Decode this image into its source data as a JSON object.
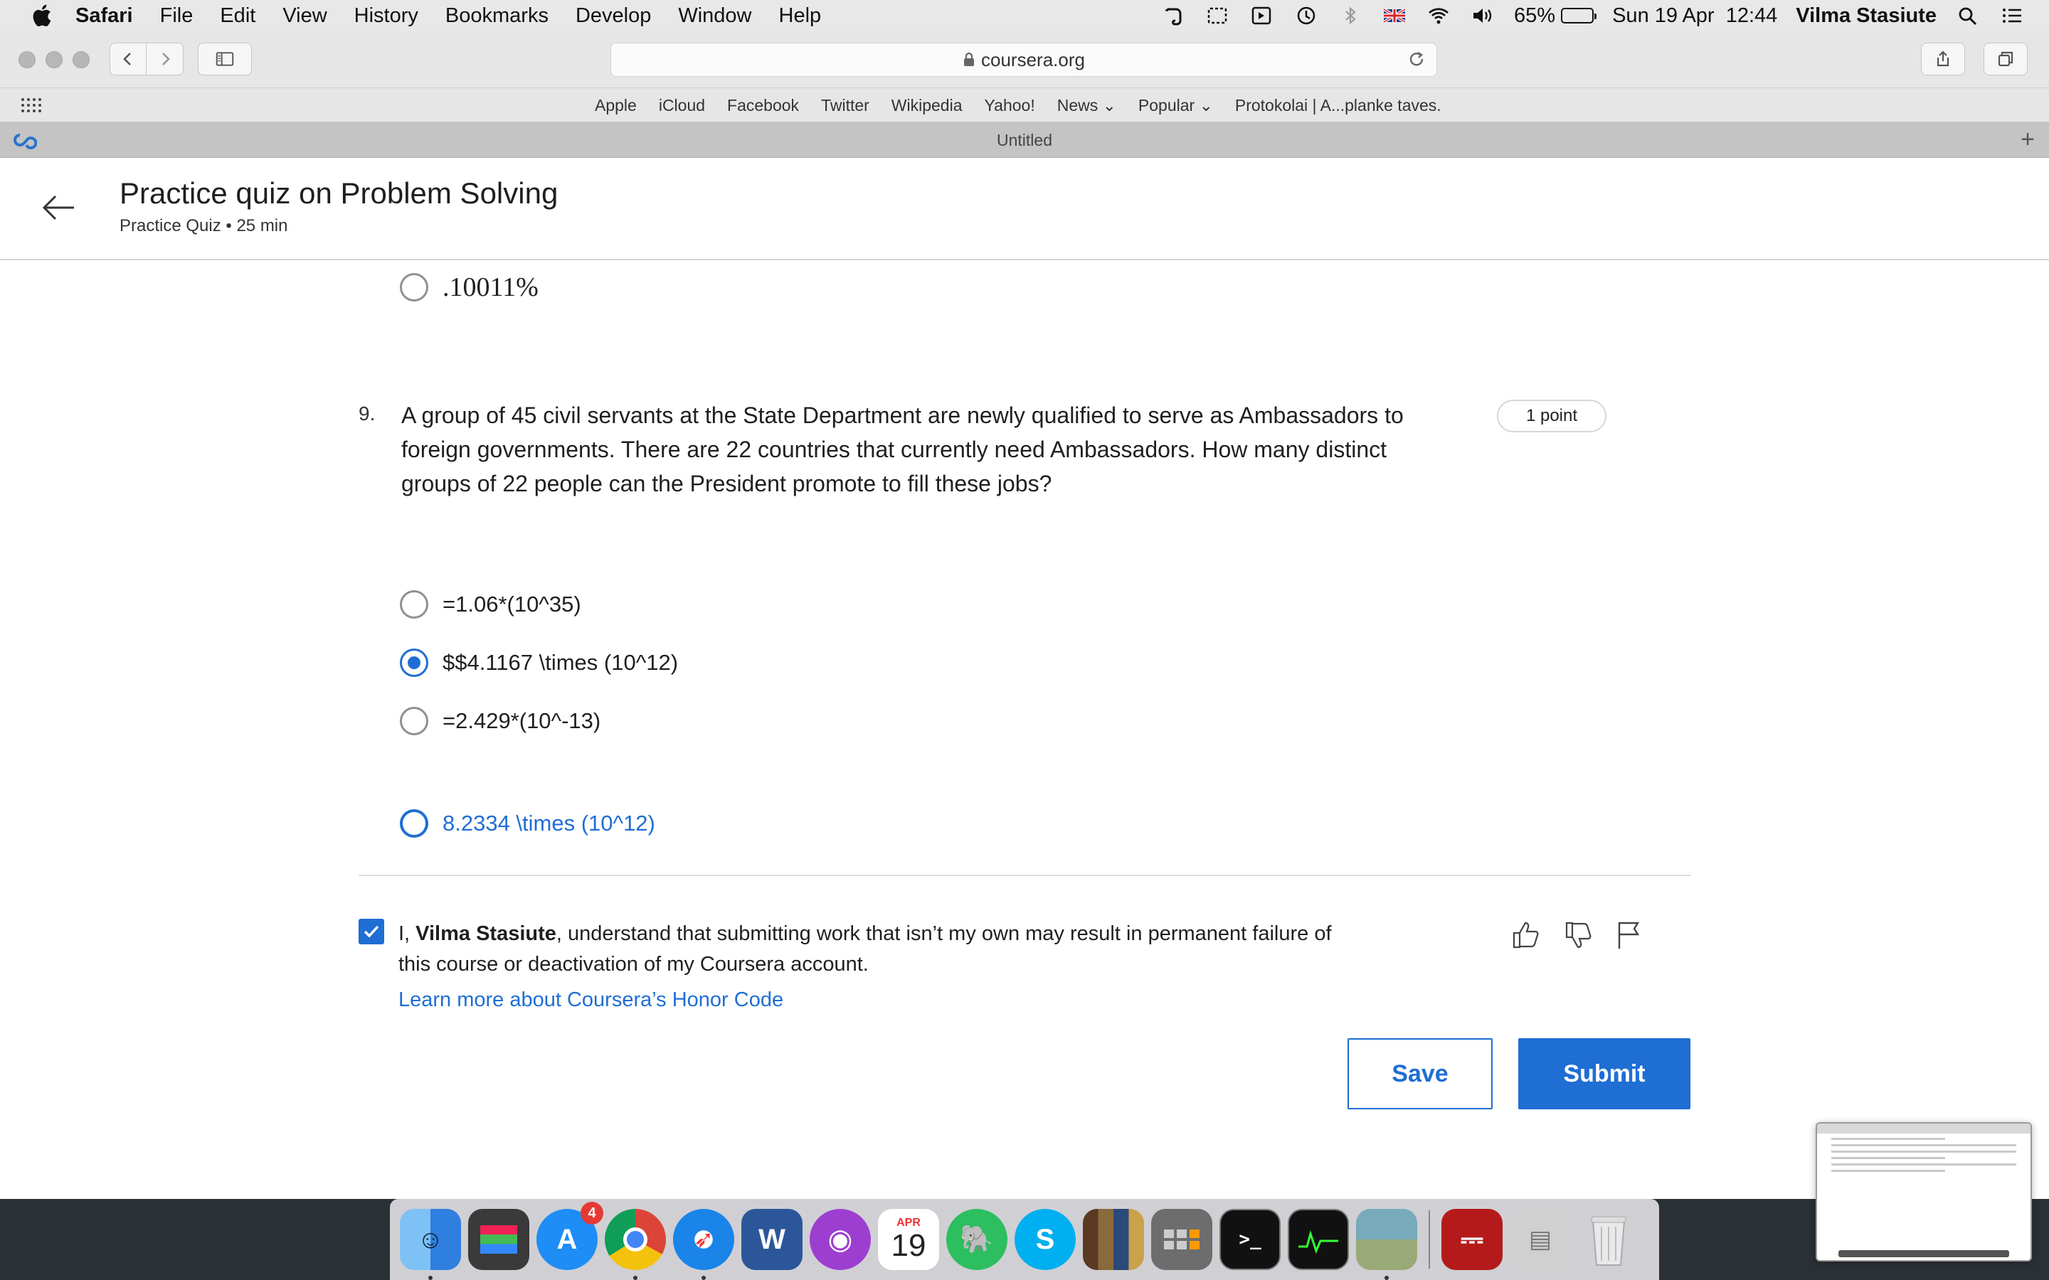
{
  "menubar": {
    "app": "Safari",
    "items": [
      "File",
      "Edit",
      "View",
      "History",
      "Bookmarks",
      "Develop",
      "Window",
      "Help"
    ],
    "battery": "65%",
    "battery_level": 0.65,
    "datetime": "Sun 19 Apr  12:44",
    "user": "Vilma Stasiute"
  },
  "browser": {
    "url": "coursera.org",
    "favorites": [
      "Apple",
      "iCloud",
      "Facebook",
      "Twitter",
      "Wikipedia",
      "Yahoo!",
      "News",
      "Popular",
      "Protokolai | A...planke taves."
    ],
    "tab_title": "Untitled"
  },
  "quiz": {
    "title": "Practice quiz on Problem Solving",
    "meta": "Practice Quiz • 25 min",
    "prev_option": ".10011%",
    "question_number": "9.",
    "question_text": "A group of 45 civil servants at the State Department are newly qualified to serve as Ambassadors to foreign governments. There are 22 countries that currently need Ambassadors. How many distinct groups of 22 people can the President promote to fill these jobs?",
    "points": "1 point",
    "options": [
      {
        "label": "=1.06*(10^35)",
        "state": "unselected"
      },
      {
        "label": "$$4.1167 \\times (10^12)",
        "state": "selected"
      },
      {
        "label": "=2.429*(10^-13)",
        "state": "unselected"
      },
      {
        "label": "8.2334 \\times (10^12)",
        "state": "hover"
      }
    ]
  },
  "honor": {
    "prefix": "I, ",
    "name": "Vilma Stasiute",
    "statement": ", understand that submitting work that isn’t my own may result in permanent failure of this course or deactivation of my Coursera account.",
    "link": "Learn more about Coursera’s Honor Code",
    "checked": true
  },
  "actions": {
    "save": "Save",
    "submit": "Submit"
  },
  "dock": {
    "app_store_badge": "4",
    "calendar_month": "APR",
    "calendar_day": "19"
  },
  "colors": {
    "accent": "#1f6ed4",
    "text": "#1f1f1f"
  }
}
